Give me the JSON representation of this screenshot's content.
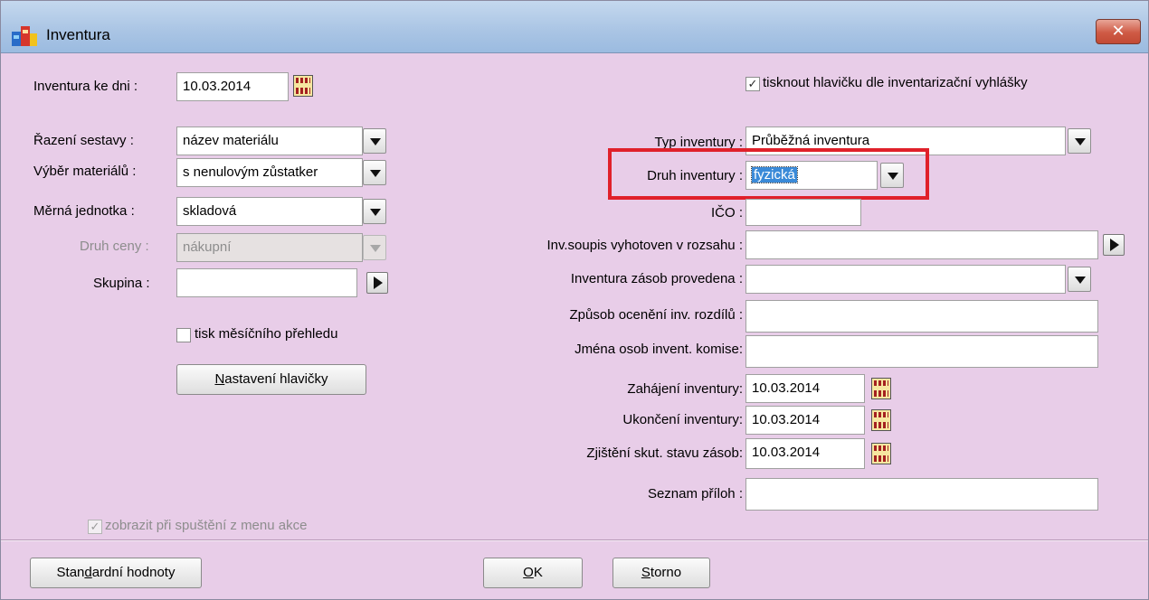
{
  "window": {
    "title": "Inventura",
    "close_glyph": "✕",
    "icon": "app-icon"
  },
  "left": {
    "inventura_ke_dni": {
      "label": "Inventura ke dni :",
      "value": "10.03.2014"
    },
    "razeni": {
      "label": "Řazení sestavy :",
      "value": "název materiálu"
    },
    "vyber": {
      "label": "Výběr materiálů :",
      "value": "s nenulovým zůstatker"
    },
    "jednotka": {
      "label": "Měrná jednotka :",
      "value": "skladová"
    },
    "druh_ceny": {
      "label": "Druh ceny :",
      "value": "nákupní"
    },
    "skupina": {
      "label": "Skupina :",
      "value": ""
    },
    "tisk_mesicniho": {
      "label": "tisk měsíčního přehledu",
      "checked": false
    },
    "nastaveni_btn": {
      "label": "Nastavení hlavičky",
      "mnemonic": "N"
    },
    "zobrazit": {
      "label": "zobrazit při spuštění z menu akce",
      "checked": true
    }
  },
  "right": {
    "tisknout_hlavicku": {
      "label": "tisknout hlavičku dle inventarizační vyhlášky",
      "checked": true
    },
    "typ": {
      "label": "Typ inventury :",
      "value": "Průběžná inventura"
    },
    "druh": {
      "label": "Druh inventury :",
      "value": "fyzická"
    },
    "ico": {
      "label": "IČO :",
      "value": ""
    },
    "soupis": {
      "label": "Inv.soupis vyhotoven v rozsahu :",
      "value": ""
    },
    "provedena": {
      "label": "Inventura zásob provedena :",
      "value": ""
    },
    "oceneni": {
      "label": "Způsob ocenění inv. rozdílů :",
      "value": ""
    },
    "komise": {
      "label": "Jména osob invent. komise:",
      "value": ""
    },
    "zahajeni": {
      "label": "Zahájení inventury:",
      "value": "10.03.2014"
    },
    "ukonceni": {
      "label": "Ukončení inventury:",
      "value": "10.03.2014"
    },
    "zjisteni": {
      "label": "Zjištění skut. stavu zásob:",
      "value": "10.03.2014"
    },
    "prilohy": {
      "label": "Seznam příloh :",
      "value": ""
    }
  },
  "footer": {
    "standard": {
      "pre": "Stan",
      "mn": "d",
      "post": "ardní hodnoty"
    },
    "ok": {
      "mn": "O",
      "post": "K"
    },
    "storno": {
      "mn": "S",
      "post": "torno"
    }
  },
  "colors": {
    "background": "#e8cde8",
    "highlight": "#e0202a",
    "selection": "#3a8ad8"
  }
}
